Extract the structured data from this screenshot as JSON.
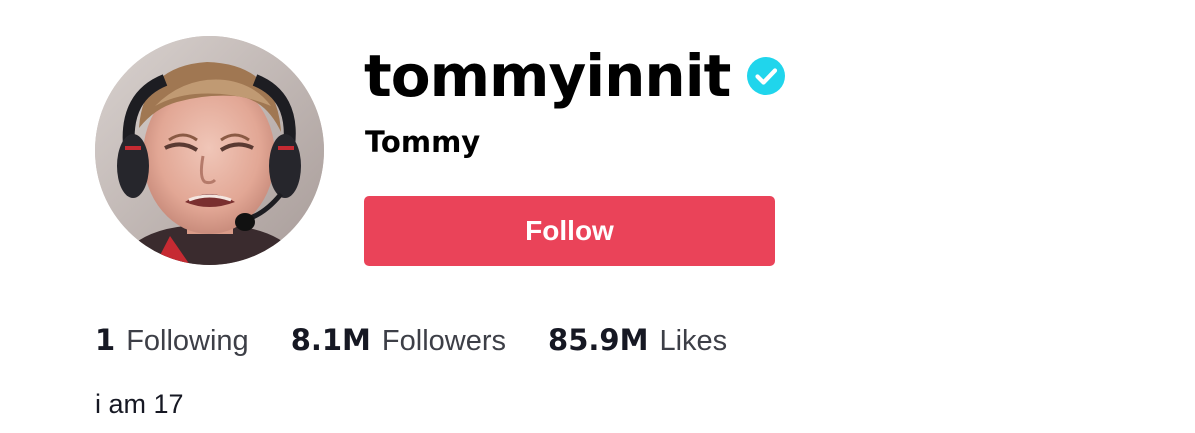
{
  "profile": {
    "username": "tommyinnit",
    "nickname": "Tommy",
    "verified": true,
    "verified_icon": "verified-checkmark-icon",
    "avatar_icon": "avatar-photo",
    "follow_label": "Follow",
    "bio": "i am 17"
  },
  "stats": [
    {
      "count": "1",
      "label": "Following"
    },
    {
      "count": "8.1M",
      "label": "Followers"
    },
    {
      "count": "85.9M",
      "label": "Likes"
    }
  ],
  "colors": {
    "follow_button": "#ea4359",
    "verified_badge": "#20d5ec",
    "text_primary": "#161823",
    "text_secondary": "#3d3f47"
  }
}
